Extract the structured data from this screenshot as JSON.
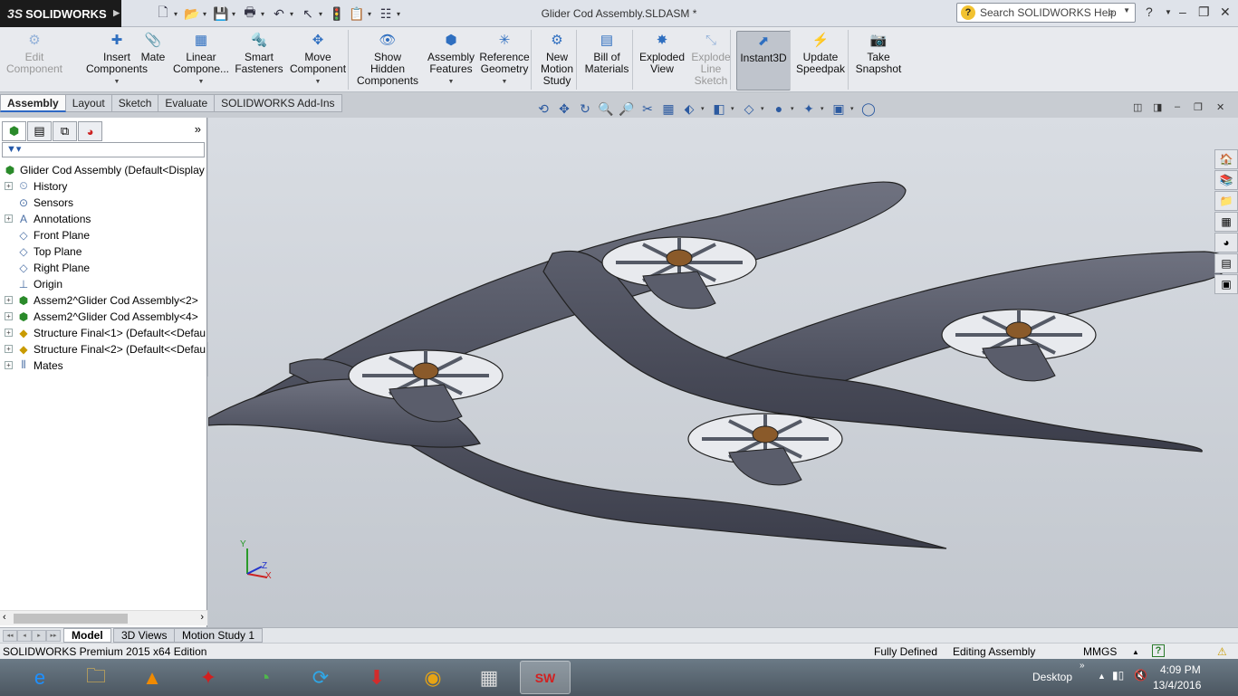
{
  "app": {
    "logo_text": "SOLIDWORKS",
    "logo_ds": "3S",
    "doc_title": "Glider Cod Assembly.SLDASM *",
    "search_placeholder": "Search SOLIDWORKS Help"
  },
  "quick_access": [
    {
      "icon": "new-document-icon",
      "glyph": "🗋"
    },
    {
      "icon": "open-folder-icon",
      "glyph": "📂"
    },
    {
      "icon": "save-icon",
      "glyph": "💾"
    },
    {
      "icon": "print-icon",
      "glyph": "🖶"
    },
    {
      "icon": "undo-icon",
      "glyph": "↶"
    },
    {
      "icon": "select-arrow-icon",
      "glyph": "↖"
    },
    {
      "icon": "rebuild-traffic-light-icon",
      "glyph": "🚦"
    },
    {
      "icon": "file-properties-icon",
      "glyph": "📋"
    },
    {
      "icon": "options-icon",
      "glyph": "☷"
    }
  ],
  "commands": [
    {
      "label1": "Edit",
      "label2": "Component",
      "label3": "",
      "icon": "edit-component-icon",
      "glyph": "⚙",
      "disabled": true,
      "dropdown": false
    },
    {
      "label1": "Insert",
      "label2": "Components",
      "label3": "",
      "icon": "insert-components-icon",
      "glyph": "✚",
      "disabled": false,
      "dropdown": true
    },
    {
      "label1": "Mate",
      "label2": "",
      "label3": "",
      "icon": "mate-paperclip-icon",
      "glyph": "📎",
      "disabled": false,
      "dropdown": false
    },
    {
      "label1": "Linear",
      "label2": "Compone...",
      "label3": "",
      "icon": "linear-pattern-icon",
      "glyph": "▦",
      "disabled": false,
      "dropdown": true
    },
    {
      "label1": "Smart",
      "label2": "Fasteners",
      "label3": "",
      "icon": "smart-fasteners-icon",
      "glyph": "🔩",
      "disabled": false,
      "dropdown": false
    },
    {
      "label1": "Move",
      "label2": "Component",
      "label3": "",
      "icon": "move-component-icon",
      "glyph": "✥",
      "disabled": false,
      "dropdown": true
    },
    {
      "label1": "Show",
      "label2": "Hidden",
      "label3": "Components",
      "icon": "show-hidden-icon",
      "glyph": "👁",
      "disabled": false,
      "dropdown": false
    },
    {
      "label1": "Assembly",
      "label2": "Features",
      "label3": "",
      "icon": "assembly-features-icon",
      "glyph": "⬢",
      "disabled": false,
      "dropdown": true
    },
    {
      "label1": "Reference",
      "label2": "Geometry",
      "label3": "",
      "icon": "reference-geometry-icon",
      "glyph": "✳",
      "disabled": false,
      "dropdown": true
    },
    {
      "label1": "New",
      "label2": "Motion",
      "label3": "Study",
      "icon": "motion-study-icon",
      "glyph": "⚙",
      "disabled": false,
      "dropdown": false
    },
    {
      "label1": "Bill of",
      "label2": "Materials",
      "label3": "",
      "icon": "bill-of-materials-icon",
      "glyph": "▤",
      "disabled": false,
      "dropdown": false
    },
    {
      "label1": "Exploded",
      "label2": "View",
      "label3": "",
      "icon": "exploded-view-icon",
      "glyph": "✸",
      "disabled": false,
      "dropdown": false
    },
    {
      "label1": "Explode",
      "label2": "Line",
      "label3": "Sketch",
      "icon": "explode-line-sketch-icon",
      "glyph": "⤡",
      "disabled": true,
      "dropdown": false
    },
    {
      "label1": "Instant3D",
      "label2": "",
      "label3": "",
      "icon": "instant3d-icon",
      "glyph": "⬈",
      "disabled": false,
      "dropdown": false,
      "active": true
    },
    {
      "label1": "Update",
      "label2": "Speedpak",
      "label3": "",
      "icon": "update-speedpak-icon",
      "glyph": "⚡",
      "disabled": false,
      "dropdown": false
    },
    {
      "label1": "Take",
      "label2": "Snapshot",
      "label3": "",
      "icon": "take-snapshot-icon",
      "glyph": "📷",
      "disabled": false,
      "dropdown": false
    }
  ],
  "tabs": [
    "Assembly",
    "Layout",
    "Sketch",
    "Evaluate",
    "SOLIDWORKS Add-Ins"
  ],
  "active_tab": "Assembly",
  "view_tools": [
    {
      "icon": "previous-view-icon",
      "glyph": "⟲"
    },
    {
      "icon": "pan-icon",
      "glyph": "✥"
    },
    {
      "icon": "rotate-view-icon",
      "glyph": "↻"
    },
    {
      "icon": "zoom-to-fit-icon",
      "glyph": "🔍"
    },
    {
      "icon": "zoom-to-area-icon",
      "glyph": "🔎"
    },
    {
      "icon": "section-view-icon",
      "glyph": "✂"
    },
    {
      "icon": "dynamic-annotation-icon",
      "glyph": "▦"
    },
    {
      "icon": "view-orientation-icon",
      "glyph": "⬖"
    },
    {
      "icon": "display-style-icon",
      "glyph": "◧"
    },
    {
      "icon": "hide-show-items-icon",
      "glyph": "◇"
    },
    {
      "icon": "edit-appearance-icon",
      "glyph": "●"
    },
    {
      "icon": "apply-scene-icon",
      "glyph": "✦"
    },
    {
      "icon": "view-settings-icon",
      "glyph": "▣"
    },
    {
      "icon": "render-tools-icon",
      "glyph": "◯"
    }
  ],
  "tree": {
    "root": "Glider Cod Assembly  (Default<Display",
    "items": [
      {
        "label": "History",
        "icon": "history-icon",
        "glyph": "⏲",
        "expandable": true
      },
      {
        "label": "Sensors",
        "icon": "sensors-icon",
        "glyph": "⊙",
        "expandable": false
      },
      {
        "label": "Annotations",
        "icon": "annotations-icon",
        "glyph": "A",
        "expandable": true
      },
      {
        "label": "Front Plane",
        "icon": "plane-icon",
        "glyph": "◇",
        "expandable": false
      },
      {
        "label": "Top Plane",
        "icon": "plane-icon",
        "glyph": "◇",
        "expandable": false
      },
      {
        "label": "Right Plane",
        "icon": "plane-icon",
        "glyph": "◇",
        "expandable": false
      },
      {
        "label": "Origin",
        "icon": "origin-icon",
        "glyph": "⊥",
        "expandable": false
      },
      {
        "label": "Assem2^Glider Cod Assembly<2>",
        "icon": "subassembly-icon",
        "glyph": "⬢",
        "expandable": true
      },
      {
        "label": "Assem2^Glider Cod Assembly<4>",
        "icon": "subassembly-icon",
        "glyph": "⬢",
        "expandable": true
      },
      {
        "label": "Structure Final<1> (Default<<Defau",
        "icon": "part-icon",
        "glyph": "◆",
        "expandable": true
      },
      {
        "label": "Structure Final<2> (Default<<Defau",
        "icon": "part-icon",
        "glyph": "◆",
        "expandable": true
      },
      {
        "label": "Mates",
        "icon": "mates-icon",
        "glyph": "⫴",
        "expandable": true
      }
    ]
  },
  "axes": {
    "x": "X",
    "y": "Y",
    "z": "Z"
  },
  "bottom_tabs": [
    "Model",
    "3D Views",
    "Motion Study 1"
  ],
  "active_bottom_tab": "Model",
  "status": {
    "product": "SOLIDWORKS Premium 2015 x64 Edition",
    "state": "Fully Defined",
    "mode": "Editing Assembly",
    "units": "MMGS"
  },
  "taskbar": {
    "apps": [
      {
        "icon": "internet-explorer-icon",
        "glyph": "e",
        "color": "#1e90ff"
      },
      {
        "icon": "file-explorer-icon",
        "glyph": "🗀",
        "color": "#f3c14b"
      },
      {
        "icon": "vlc-icon",
        "glyph": "▲",
        "color": "#f08a00"
      },
      {
        "icon": "acrobat-icon",
        "glyph": "✦",
        "color": "#d21f1f"
      },
      {
        "icon": "nox-app-icon",
        "glyph": "◔",
        "color": "#4fb84b"
      },
      {
        "icon": "sync-app-icon",
        "glyph": "⟳",
        "color": "#2fa8e8"
      },
      {
        "icon": "downloader-icon",
        "glyph": "⬇",
        "color": "#d22c2c"
      },
      {
        "icon": "chrome-icon",
        "glyph": "◉",
        "color": "#e7a414"
      },
      {
        "icon": "calculator-icon",
        "glyph": "▦",
        "color": "#dcdcdc"
      },
      {
        "icon": "solidworks-2015-icon",
        "glyph": "SW",
        "color": "#d22020",
        "active": true
      }
    ],
    "desktop_label": "Desktop",
    "time": "4:09 PM",
    "date": "13/4/2016"
  }
}
